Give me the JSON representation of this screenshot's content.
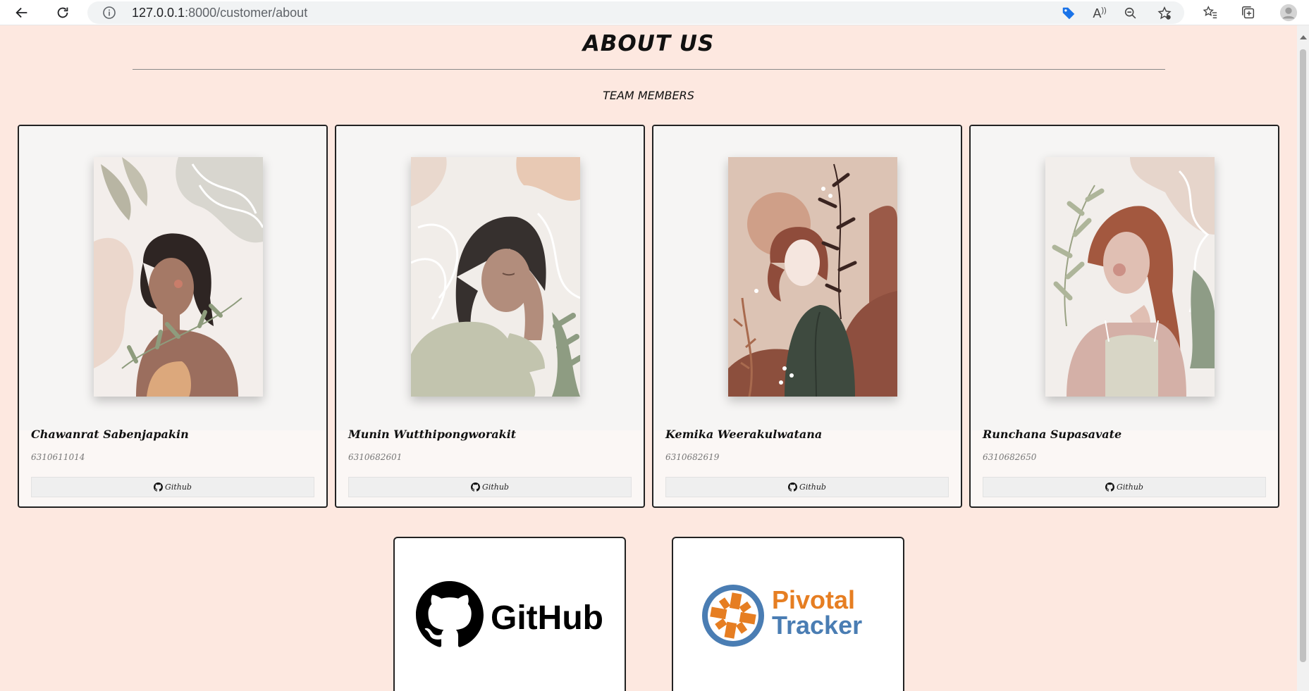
{
  "browser": {
    "url_host": "127.0.0.1",
    "url_path": ":8000/customer/about",
    "read_aloud_label": "A"
  },
  "page": {
    "title": "ABOUT US",
    "subtitle": "TEAM MEMBERS"
  },
  "members": [
    {
      "name": "Chawanrat Sabenjapakin",
      "student_id": "6310611014",
      "button_label": "Github"
    },
    {
      "name": "Munin Wutthipongworakit",
      "student_id": "6310682601",
      "button_label": "Github"
    },
    {
      "name": "Kemika Weerakulwatana",
      "student_id": "6310682619",
      "button_label": "Github"
    },
    {
      "name": "Runchana Supasavate",
      "student_id": "6310682650",
      "button_label": "Github"
    }
  ],
  "tools": [
    {
      "name": "GitHub",
      "icon": "github-logo"
    },
    {
      "name": "Pivotal Tracker",
      "line1": "Pivotal",
      "line2": "Tracker",
      "icon": "pivotal-tracker-logo"
    }
  ],
  "colors": {
    "page_background": "#fde8e0",
    "card_background": "#fbf7f5",
    "pivotal_orange": "#e67e22",
    "pivotal_blue": "#4a7db3"
  }
}
